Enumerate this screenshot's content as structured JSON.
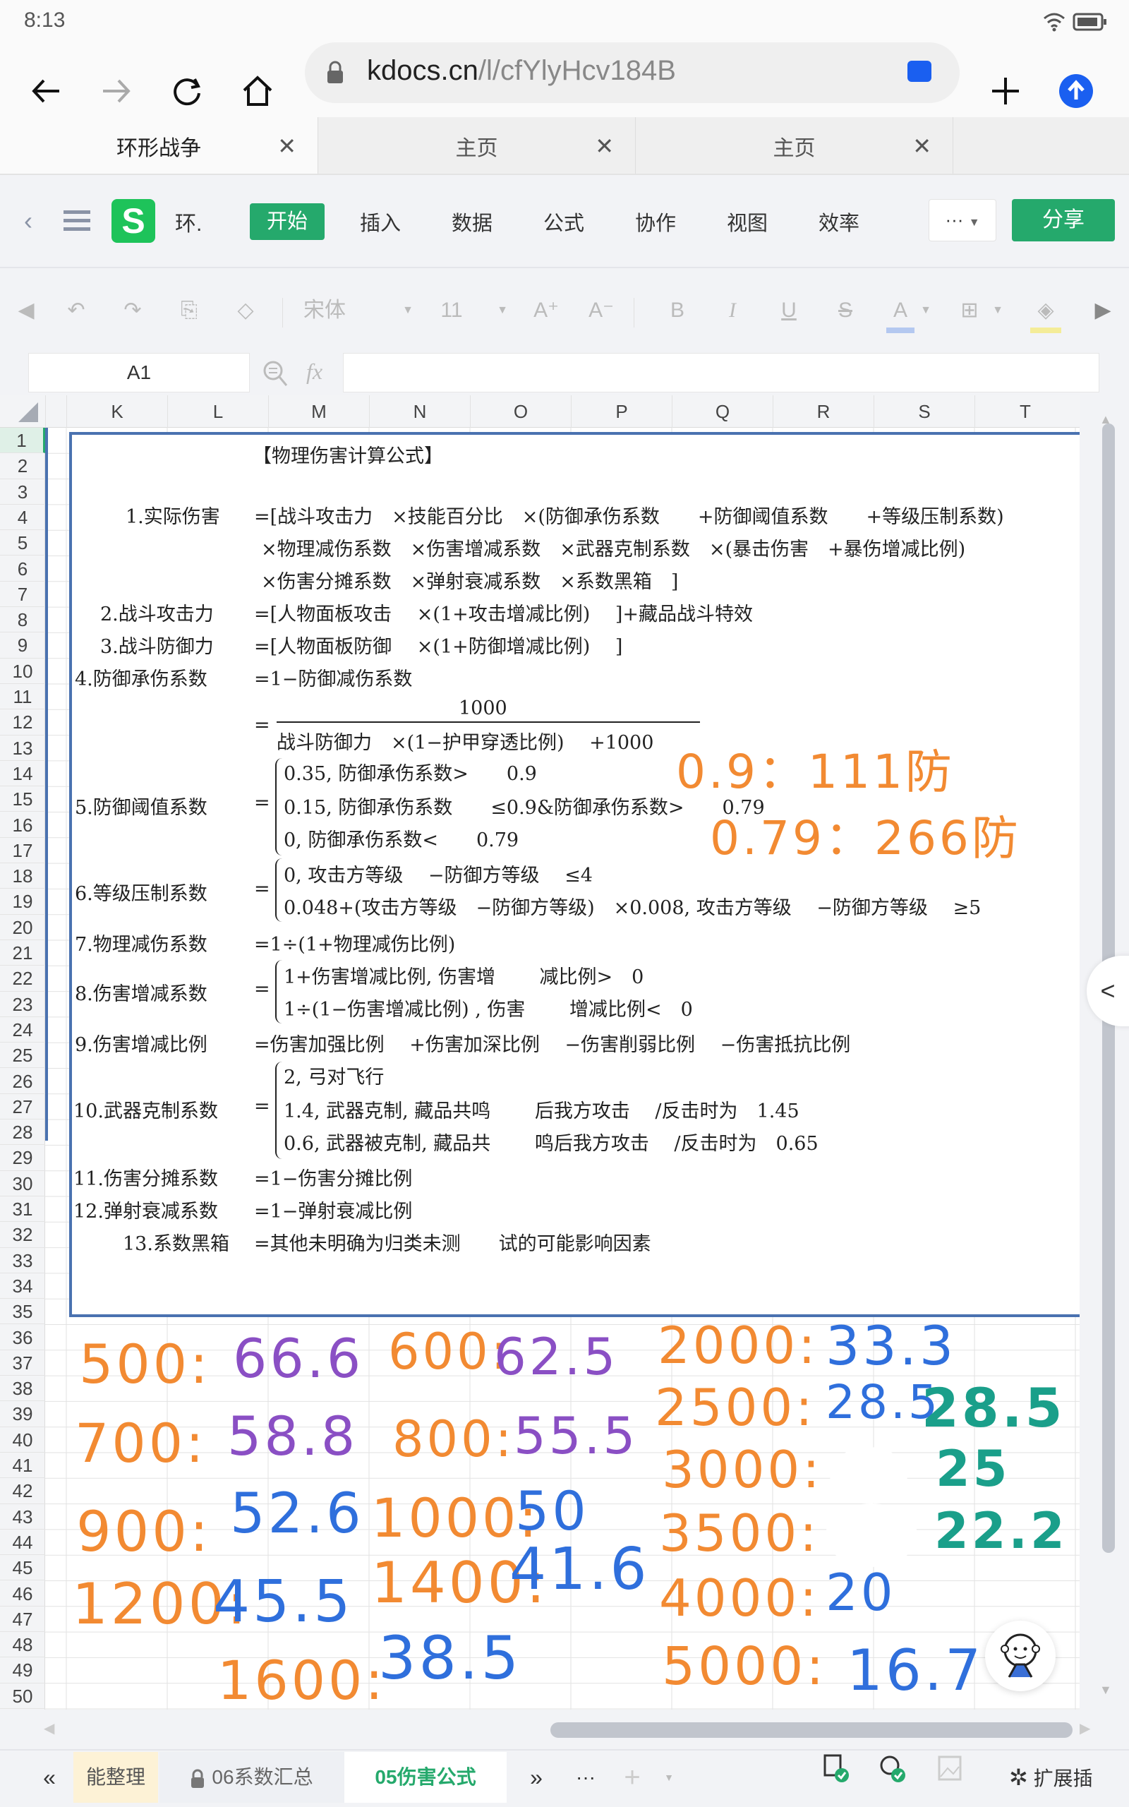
{
  "status": {
    "time": "8:13"
  },
  "browser": {
    "url_domain": "kdocs.cn",
    "url_path": "/l/cfYlyHcv184B",
    "tabs": [
      {
        "label": "环形战争",
        "active": true
      },
      {
        "label": "主页",
        "active": false
      },
      {
        "label": "主页",
        "active": false
      }
    ],
    "tab_close": "✕"
  },
  "app": {
    "logo": "S",
    "doc_short": "环.",
    "menu_tabs": [
      "开始",
      "插入",
      "数据",
      "公式",
      "协作",
      "视图",
      "效率"
    ],
    "more_label": "···",
    "share_label": "分享"
  },
  "format_toolbar": {
    "font": "宋体",
    "size": "11",
    "grow": "A⁺",
    "shrink": "A⁻",
    "bold": "B",
    "italic": "I",
    "underline": "U",
    "strike": "S",
    "font_color": "A",
    "font_color_hex": "#b4c8f0",
    "fill_color_hex": "#f4ec98"
  },
  "formula_bar": {
    "cell_ref": "A1",
    "fx": "fx",
    "value": ""
  },
  "grid": {
    "columns": [
      "K",
      "L",
      "M",
      "N",
      "O",
      "P",
      "Q",
      "R",
      "S",
      "T"
    ],
    "row_start": 1,
    "row_end": 50,
    "selected_row": 1
  },
  "formula_sheet": {
    "title": "【物理伤害计算公式】",
    "items": [
      {
        "label": "1.实际伤害",
        "lines": [
          "=[战斗攻击力　×技能百分比　×(防御承伤系数　　+防御阈值系数　　+等级压制系数)",
          "×物理减伤系数　×伤害增减系数　×武器克制系数　×(暴击伤害　+暴伤增减比例)",
          "×伤害分摊系数　×弹射衰减系数　×系数黑箱　]"
        ]
      },
      {
        "label": "2.战斗攻击力",
        "lines": [
          "=[人物面板攻击　 ×(1+攻击增减比例)　 ]+藏品战斗特效"
        ]
      },
      {
        "label": "3.战斗防御力",
        "lines": [
          "=[人物面板防御　 ×(1+防御增减比例)　 ]"
        ]
      },
      {
        "label": "4.防御承伤系数",
        "lines": [
          "=1−防御减伤系数"
        ],
        "fraction": {
          "numerator": "1000",
          "denominator": "战斗防御力　×(1−护甲穿透比例)　 +1000"
        }
      },
      {
        "label": "5.防御阈值系数",
        "cases": [
          "0.35,  防御承伤系数>　　0.9",
          "0.15,  防御承伤系数　　≤0.9&防御承伤系数>　　0.79",
          "0,  防御承伤系数<　　0.79"
        ]
      },
      {
        "label": "6.等级压制系数",
        "cases": [
          "0,  攻击方等级　 −防御方等级　 ≤4",
          "0.048+(攻击方等级　−防御方等级)　×0.008,  攻击方等级　 −防御方等级　 ≥5"
        ]
      },
      {
        "label": "7.物理减伤系数",
        "lines": [
          "=1÷(1+物理减伤比例)"
        ]
      },
      {
        "label": "8.伤害增减系数",
        "cases": [
          "1+伤害增减比例,  伤害增　　 减比例>　0",
          "1÷(1−伤害增减比例) ,  伤害　　 增减比例<　0"
        ]
      },
      {
        "label": "9.伤害增减比例",
        "lines": [
          "=伤害加强比例　 +伤害加深比例　 −伤害削弱比例　 −伤害抵抗比例"
        ]
      },
      {
        "label": "10.武器克制系数",
        "cases": [
          "2,  弓对飞行",
          "1.4,  武器克制,  藏品共鸣　　 后我方攻击　 /反击时为　1.45",
          "0.6,  武器被克制,  藏品共　　 鸣后我方攻击　 /反击时为　0.65"
        ]
      },
      {
        "label": "11.伤害分摊系数",
        "lines": [
          "=1−伤害分摊比例"
        ]
      },
      {
        "label": "12.弹射衰减系数",
        "lines": [
          "=1−弹射衰减比例"
        ]
      },
      {
        "label": "13.系数黑箱",
        "lines": [
          "=其他未明确为归类未测　　试的可能影响因素"
        ]
      }
    ],
    "equals": "="
  },
  "annotations": {
    "threshold_notes": [
      "0.9：111防",
      "0.79：266防"
    ],
    "defense_table": [
      {
        "defense": "500:",
        "value": "66.6",
        "color": "purple"
      },
      {
        "defense": "600:",
        "value": "62.5",
        "color": "purple"
      },
      {
        "defense": "700:",
        "value": "58.8",
        "color": "purple"
      },
      {
        "defense": "800:",
        "value": "55.5",
        "color": "purple"
      },
      {
        "defense": "900:",
        "value": "52.6",
        "color": "blue"
      },
      {
        "defense": "1000:",
        "value": "50",
        "color": "blue"
      },
      {
        "defense": "1200:",
        "value": "45.5",
        "color": "blue"
      },
      {
        "defense": "1400:",
        "value": "41.6",
        "color": "blue"
      },
      {
        "defense": "1600:",
        "value": "38.5",
        "color": "blue"
      },
      {
        "defense": "2000:",
        "value": "33.3",
        "color": "blue"
      },
      {
        "defense": "2500:",
        "value": "28.5",
        "color": "blue",
        "extra": "28.5"
      },
      {
        "defense": "3000:",
        "value": "",
        "color": "blue",
        "extra": "25"
      },
      {
        "defense": "3500:",
        "value": "",
        "color": "blue",
        "extra": "22.2"
      },
      {
        "defense": "4000:",
        "value": "20",
        "color": "blue"
      },
      {
        "defense": "5000:",
        "value": "16.7",
        "color": "blue"
      }
    ]
  },
  "sheet_tabs": {
    "prev": "«",
    "tabs": [
      {
        "label": "能整理",
        "locked": false,
        "active": false
      },
      {
        "label": "06系数汇总",
        "locked": true,
        "active": false
      },
      {
        "label": "05伤害公式",
        "locked": false,
        "active": true
      }
    ],
    "next": "»",
    "more": "···",
    "add": "+",
    "extensions_label": "扩展插"
  },
  "side_collapse": "<"
}
